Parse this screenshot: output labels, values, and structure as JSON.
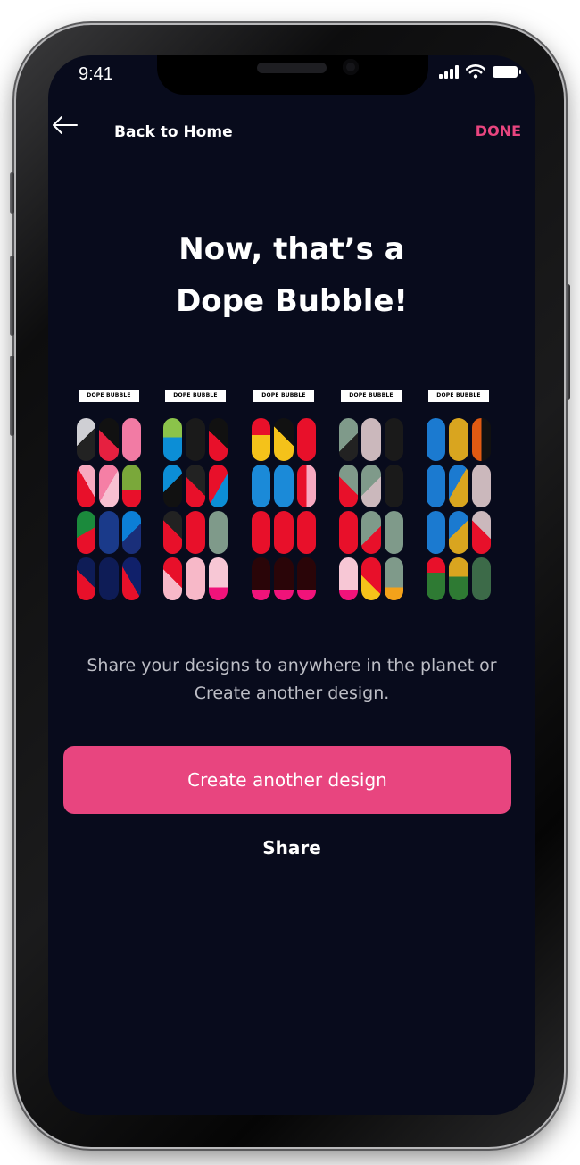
{
  "status_bar": {
    "time": "9:41"
  },
  "nav": {
    "back_icon": "arrow-left-icon",
    "back_label": "Back to Home",
    "done_label": "DONE"
  },
  "headline": {
    "line1": "Now, that’s a",
    "line2": "Dope Bubble!"
  },
  "designs": [
    {
      "label": "DOPE BUBBLE"
    },
    {
      "label": "DOPE BUBBLE"
    },
    {
      "label": "DOPE BUBBLE"
    },
    {
      "label": "DOPE BUBBLE"
    },
    {
      "label": "DOPE BUBBLE"
    }
  ],
  "description": "Share your designs to anywhere in the planet or Create another design.",
  "actions": {
    "primary_label": "Create another design",
    "secondary_label": "Share"
  },
  "colors": {
    "background": "#080b1c",
    "accent": "#e8457f",
    "text": "#ffffff",
    "muted_text": "#bdbec6"
  }
}
